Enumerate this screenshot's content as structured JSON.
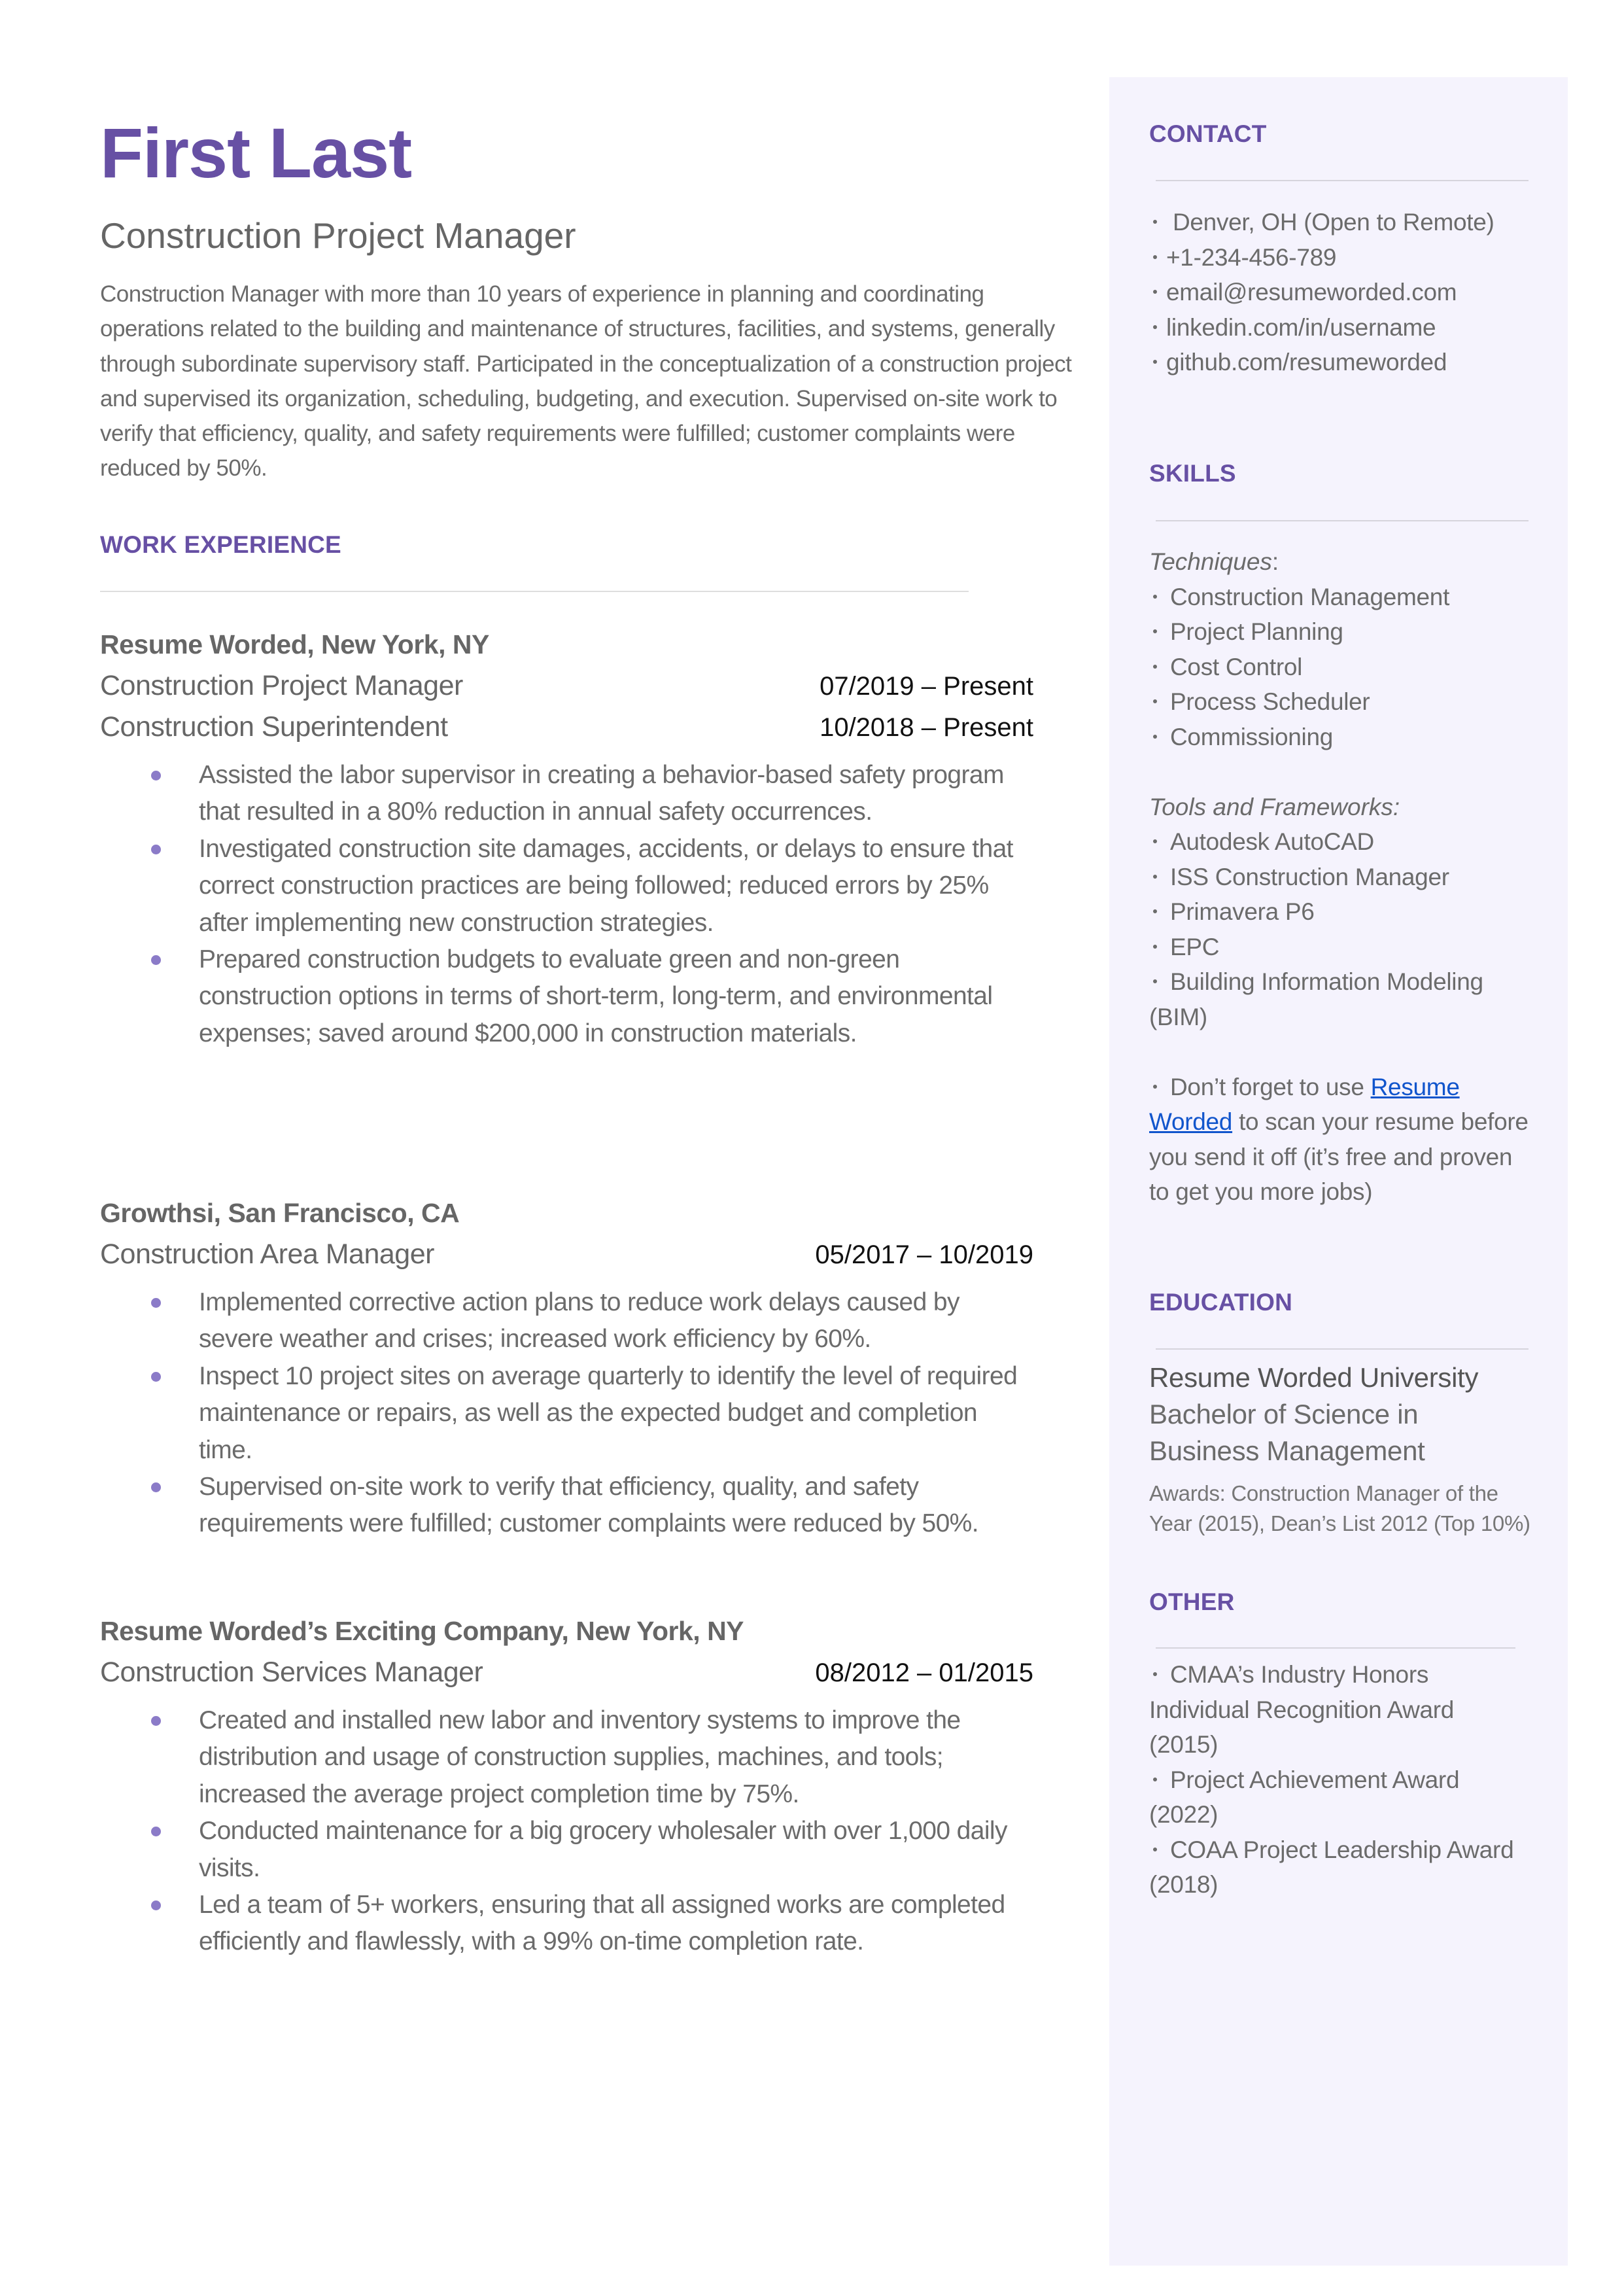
{
  "header": {
    "name": "First Last",
    "title": "Construction Project Manager",
    "summary": "Construction Manager with more than 10 years of experience in planning and coordinating operations related to the building and maintenance of structures, facilities, and systems, generally through subordinate supervisory staff. Participated in the conceptualization of a construction project and supervised its organization, scheduling, budgeting, and execution. Supervised on-site work to verify that efficiency, quality, and safety requirements were fulfilled; customer complaints were reduced by 50%."
  },
  "work": {
    "heading": "WORK EXPERIENCE",
    "jobs": [
      {
        "company": "Resume Worded, New York, NY",
        "roles": [
          {
            "title": "Construction Project Manager",
            "dates": "07/2019 – Present"
          },
          {
            "title": "Construction Superintendent",
            "dates": "10/2018 – Present"
          }
        ],
        "bullets": [
          "Assisted the labor supervisor in creating a behavior-based safety program that resulted in a 80% reduction in annual safety occurrences.",
          "Investigated construction site damages, accidents, or delays to ensure that correct construction practices are being followed; reduced errors by 25% after implementing new construction strategies.",
          "Prepared construction budgets to evaluate green and non-green construction options in terms of short-term, long-term, and environmental expenses; saved around $200,000 in construction materials."
        ]
      },
      {
        "company": "Growthsi, San Francisco, CA",
        "roles": [
          {
            "title": "Construction Area Manager",
            "dates": "05/2017 – 10/2019"
          }
        ],
        "bullets": [
          "Implemented corrective action plans to reduce work delays caused by severe weather and crises; increased work efficiency by 60%.",
          "Inspect 10 project sites on average quarterly to identify the level of required maintenance or repairs, as well as the expected budget and completion time.",
          "Supervised on-site work to verify that efficiency, quality, and safety requirements were fulfilled; customer complaints were reduced by 50%."
        ]
      },
      {
        "company": "Resume Worded’s Exciting Company, New York, NY",
        "roles": [
          {
            "title": "Construction Services Manager",
            "dates": "08/2012 – 01/2015"
          }
        ],
        "bullets": [
          "Created and installed new labor and inventory systems to improve the distribution and usage of construction supplies, machines, and tools; increased the average project completion time by 75%.",
          "Conducted maintenance for a big grocery wholesaler with over 1,000 daily visits.",
          "Led a team of 5+ workers, ensuring that all assigned works are completed efficiently and flawlessly, with a 99% on-time completion rate."
        ]
      }
    ]
  },
  "sidebar": {
    "contact": {
      "heading": "CONTACT",
      "items": [
        " Denver, OH (Open to Remote)",
        "+1-234-456-789",
        "email@resumeworded.com",
        "linkedin.com/in/username",
        "github.com/resumeworded"
      ]
    },
    "skills": {
      "heading": "SKILLS",
      "techniques_label": "Techniques",
      "techniques_colon": ":",
      "techniques": [
        "Construction Management",
        "Project Planning",
        "Cost Control",
        "Process Scheduler",
        "Commissioning"
      ],
      "tools_label": "Tools and Frameworks:",
      "tools": [
        "Autodesk AutoCAD",
        "ISS Construction Manager",
        "Primavera P6",
        "EPC",
        "Building Information Modeling (BIM)"
      ],
      "note_before": "Don’t forget to use ",
      "note_link": "Resume Worded",
      "note_after": " to scan your resume before you send it off (it’s free and proven to get you more jobs)"
    },
    "education": {
      "heading": "EDUCATION",
      "school": "Resume Worded University",
      "degree": "Bachelor of Science in Business Management",
      "awards": "Awards: Construction Manager of the Year (2015), Dean’s List 2012 (Top 10%)"
    },
    "other": {
      "heading": "OTHER",
      "items": [
        "CMAA’s Industry Honors Individual Recognition Award (2015)",
        "Project Achievement Award (2022)",
        "COAA Project Leadership Award (2018)"
      ]
    }
  },
  "colors": {
    "accent": "#6750a4",
    "bullet": "#8b7bc8",
    "sidebar_bg": "#f5f3fd",
    "link": "#1155cc",
    "text": "#666666"
  }
}
